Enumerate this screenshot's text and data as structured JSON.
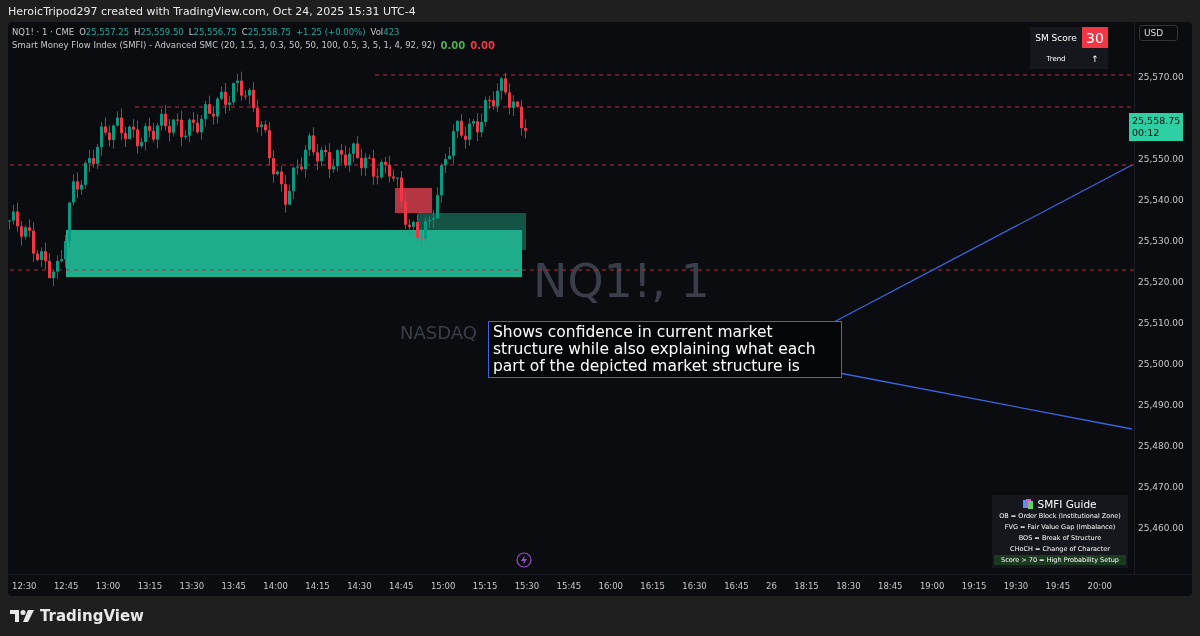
{
  "header": {
    "credit": "HeroicTripod297 created with TradingView.com, Oct 24, 2025 15:31 UTC-4"
  },
  "legend": {
    "symbol": "NQ1! · 1 · CME",
    "ohlc": [
      {
        "label": "O",
        "value": "25,557.25"
      },
      {
        "label": "H",
        "value": "25,559.50"
      },
      {
        "label": "L",
        "value": "25,556.75"
      },
      {
        "label": "C",
        "value": "25,558.75"
      }
    ],
    "change": "+1.25 (+0.00%)",
    "volume_label": "Vol",
    "volume": "423"
  },
  "indicator": {
    "name": "Smart Money Flow Index (SMFI) - Advanced SMC (20, 1.5, 3, 0.3, 50, 50, 100, 0.5, 3, 5, 1, 4, 92, 92)",
    "values": [
      {
        "text": "0.00",
        "color": "#4caf50"
      },
      {
        "text": "0.00",
        "color": "#f23645"
      }
    ]
  },
  "score_table": {
    "title": "SM Score",
    "score": "30",
    "trend_label": "Trend",
    "trend_arrow": "↑"
  },
  "currency": "USD",
  "price_axis": {
    "labels": [
      "25,570.00",
      "25,550.00",
      "25,540.00",
      "25,530.00",
      "25,520.00",
      "25,510.00",
      "25,500.00",
      "25,490.00",
      "25,480.00",
      "25,470.00",
      "25,460.00"
    ],
    "last_price": "25,558.75",
    "countdown": "00:12"
  },
  "watermark": {
    "symbol": "NQ1!, 1",
    "subtitle": "NASDAQ"
  },
  "callout": {
    "text": "Shows confidence in current market structure while also explaining what each part of the depicted market structure is"
  },
  "guide": {
    "title": "SMFI Guide",
    "lines": [
      {
        "text": "OB = Order Block (Institutional Zone)",
        "highlighted": false
      },
      {
        "text": "FVG = Fair Value Gap (Imbalance)",
        "highlighted": false
      },
      {
        "text": "BOS = Break of Structure",
        "highlighted": false
      },
      {
        "text": "CHoCH = Change of Character",
        "highlighted": false
      },
      {
        "text": "Score > 70 = High Probability Setup",
        "highlighted": true
      }
    ]
  },
  "time_axis": [
    "12:30",
    "12:45",
    "13:00",
    "13:15",
    "13:30",
    "13:45",
    "14:00",
    "14:15",
    "14:30",
    "14:45",
    "15:00",
    "15:15",
    "15:30",
    "15:45",
    "16:00",
    "16:15",
    "16:30",
    "16:45",
    "26",
    "18:15",
    "18:30",
    "18:45",
    "19:00",
    "19:15",
    "19:30",
    "19:45",
    "20:00"
  ],
  "footer": {
    "brand": "TradingView"
  }
}
